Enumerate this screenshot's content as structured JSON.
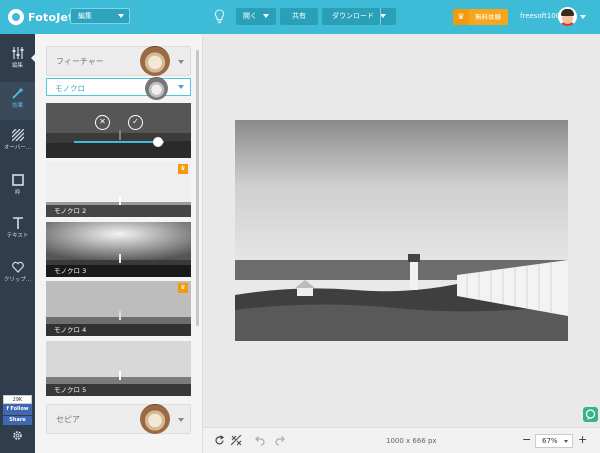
{
  "app": {
    "name": "FotoJet"
  },
  "topbar": {
    "mode": "編集",
    "open_label": "開く",
    "share_label": "共有",
    "download_label": "ダウンロード",
    "trial_label": "無料体験",
    "username": "freesoft100"
  },
  "nav": {
    "items": [
      {
        "label": "編集",
        "icon": "sliders-icon"
      },
      {
        "label": "効果",
        "icon": "magic-wand-icon",
        "active": true
      },
      {
        "label": "オーバー...",
        "icon": "overlay-stripes-icon"
      },
      {
        "label": "枠",
        "icon": "frame-icon"
      },
      {
        "label": "テキスト",
        "icon": "text-icon"
      },
      {
        "label": "クリップ...",
        "icon": "heart-icon"
      }
    ],
    "facebook": {
      "count": "29K",
      "follow": "Follow",
      "share": "Share"
    }
  },
  "panel": {
    "category_top": "フィーチャー",
    "subcategory": "モノクロ",
    "effects": [
      {
        "label": "モノクロ 2",
        "premium": true
      },
      {
        "label": "モノクロ 3",
        "premium": false
      },
      {
        "label": "モノクロ 4",
        "premium": true
      },
      {
        "label": "モノクロ 5",
        "premium": false
      }
    ],
    "category_bottom": "セピア",
    "active_effect": {
      "intensity": 0.95
    }
  },
  "canvas": {
    "dimensions": "1000 x 666 px"
  },
  "zoom": {
    "level": "67%"
  },
  "colors": {
    "accent": "#3ebbd6",
    "nav_bg": "#2f3d4c",
    "trial": "#f7a51c"
  }
}
